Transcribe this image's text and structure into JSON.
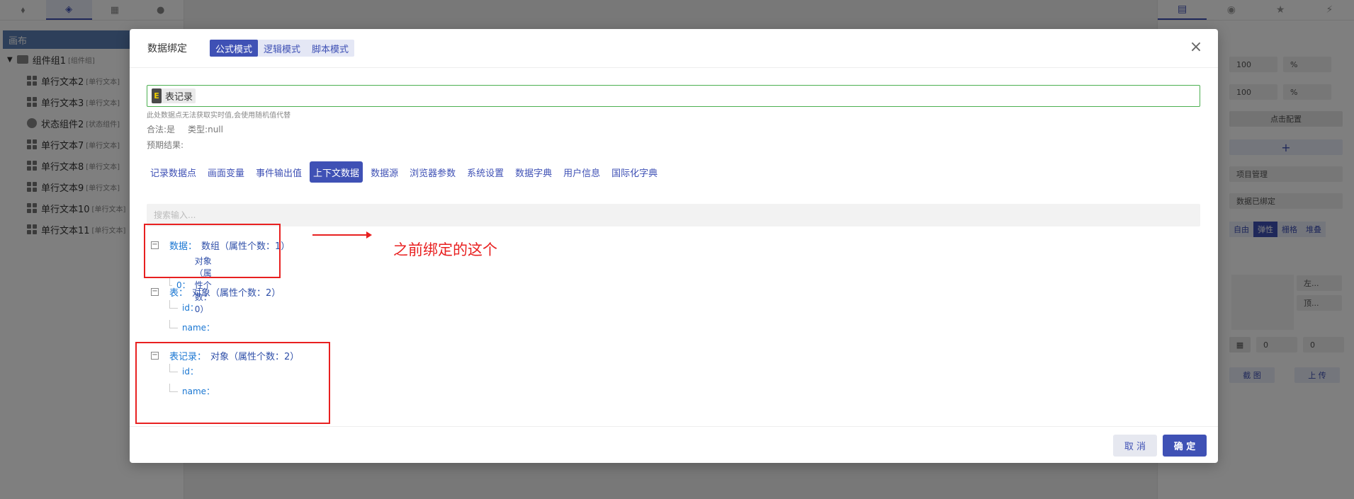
{
  "left_panel": {
    "tabs": [
      "puzzle-icon",
      "layers-icon",
      "grid-icon",
      "user-icon"
    ],
    "canvas_label": "画布",
    "group": {
      "label": "组件组1",
      "tag": "[组件组]"
    },
    "items": [
      {
        "label": "单行文本2",
        "tag": "[单行文本]"
      },
      {
        "label": "单行文本3",
        "tag": "[单行文本]"
      },
      {
        "label": "状态组件2",
        "tag": "[状态组件]"
      },
      {
        "label": "单行文本7",
        "tag": "[单行文本]"
      },
      {
        "label": "单行文本8",
        "tag": "[单行文本]"
      },
      {
        "label": "单行文本9",
        "tag": "[单行文本]"
      },
      {
        "label": "单行文本10",
        "tag": "[单行文本]"
      },
      {
        "label": "单行文本11",
        "tag": "[单行文本]"
      }
    ]
  },
  "right_panel": {
    "width_value": "100",
    "width_unit": "%",
    "height_value": "100",
    "height_unit": "%",
    "config_button": "点击配置",
    "add_button": "+",
    "project_select": "项目管理",
    "bound_label": "数据已绑定",
    "layout_modes": [
      "自由",
      "弹性",
      "栅格",
      "堆叠"
    ],
    "active_layout": "弹性",
    "align_left_select": "左...",
    "align_top_select": "顶...",
    "gap_x": "0",
    "gap_y": "0",
    "screenshot_button": "截 图",
    "upload_button": "上 传"
  },
  "modal": {
    "title": "数据绑定",
    "modes": [
      {
        "label": "公式模式",
        "active": true
      },
      {
        "label": "逻辑模式",
        "active": false
      },
      {
        "label": "脚本模式",
        "active": false
      }
    ],
    "formula_chip_letter": "E",
    "formula_chip_text": "表记录",
    "hint": "此处数据点无法获取实时值,会使用随机值代替",
    "valid_text": "合法:是",
    "type_text": "类型:null",
    "expected_text": "预期结果:",
    "source_tabs": [
      {
        "label": "记录数据点",
        "active": false
      },
      {
        "label": "画面变量",
        "active": false
      },
      {
        "label": "事件输出值",
        "active": false
      },
      {
        "label": "上下文数据",
        "active": true
      },
      {
        "label": "数据源",
        "active": false
      },
      {
        "label": "浏览器参数",
        "active": false
      },
      {
        "label": "系统设置",
        "active": false
      },
      {
        "label": "数据字典",
        "active": false
      },
      {
        "label": "用户信息",
        "active": false
      },
      {
        "label": "国际化字典",
        "active": false
      }
    ],
    "search_placeholder": "搜索输入...",
    "tree": [
      {
        "key": "数据：",
        "desc": "数组（属性个数：1）",
        "children": [
          {
            "key": "0：",
            "desc": "对象（属性个数：0）"
          }
        ]
      },
      {
        "key": "表：",
        "desc": "对象（属性个数：2）",
        "children": [
          {
            "key": "id：",
            "desc": ""
          },
          {
            "key": "name：",
            "desc": ""
          }
        ]
      },
      {
        "key": "表记录：",
        "desc": "对象（属性个数：2）",
        "children": [
          {
            "key": "id：",
            "desc": ""
          },
          {
            "key": "name：",
            "desc": ""
          }
        ]
      }
    ],
    "annotation": "之前绑定的这个",
    "cancel_label": "取 消",
    "ok_label": "确 定",
    "colors": {
      "accent": "#3f51b5",
      "annotation": "#e82020",
      "formula_border": "#4caf50"
    }
  }
}
